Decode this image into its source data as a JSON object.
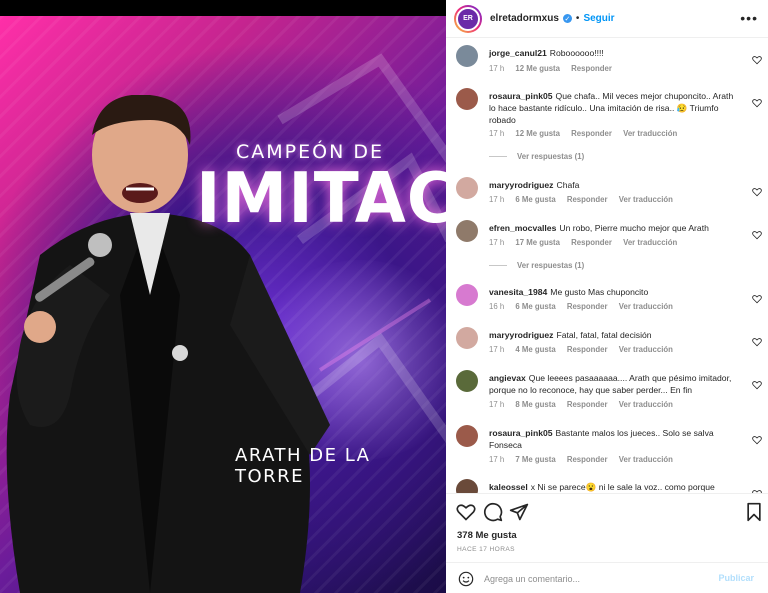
{
  "post": {
    "headline_small": "CAMPEÓN DE",
    "headline_big": "IMITACIÓN",
    "caption_name": "ARATH DE LA TORRE"
  },
  "header": {
    "username": "elretadormxus",
    "avatar_text": "EL RETADOR",
    "separator": "•",
    "follow_label": "Seguir",
    "more_label": "•••"
  },
  "comments": [
    {
      "user": "jorge_canul21",
      "text": "Roboooooo!!!!",
      "time": "17 h",
      "likes": "12 Me gusta",
      "reply": "Responder",
      "translate": "",
      "avatar_color": "#7a8a9a"
    },
    {
      "user": "rosaura_pink05",
      "text": "Que chafa.. Mil veces mejor chuponcito.. Arath lo hace bastante ridículo.. Una imitación de risa.. 😥 Triumfo robado",
      "time": "17 h",
      "likes": "12 Me gusta",
      "reply": "Responder",
      "translate": "Ver traducción",
      "avatar_color": "#9b5a4a"
    },
    {
      "user": "maryyrodriguez",
      "text": "Chafa",
      "time": "17 h",
      "likes": "6 Me gusta",
      "reply": "Responder",
      "translate": "Ver traducción",
      "avatar_color": "#d2a9a0"
    },
    {
      "user": "efren_mocvalles",
      "text": "Un robo, Pierre mucho mejor que Arath",
      "time": "17 h",
      "likes": "17 Me gusta",
      "reply": "Responder",
      "translate": "Ver traducción",
      "avatar_color": "#8f7a6a"
    },
    {
      "user": "vanesita_1984",
      "text": "Me gusto Mas chuponcito",
      "time": "16 h",
      "likes": "6 Me gusta",
      "reply": "Responder",
      "translate": "Ver traducción",
      "avatar_color": "#d77ad0"
    },
    {
      "user": "maryyrodriguez",
      "text": "Fatal, fatal, fatal decisión",
      "time": "17 h",
      "likes": "4 Me gusta",
      "reply": "Responder",
      "translate": "Ver traducción",
      "avatar_color": "#d2a9a0"
    },
    {
      "user": "angievax",
      "text": "Que leeees pasaaaaaa.... Arath que pésimo imitador, porque no lo reconoce, hay que saber perder... En fin",
      "time": "17 h",
      "likes": "8 Me gusta",
      "reply": "Responder",
      "translate": "Ver traducción",
      "avatar_color": "#5a6a3a"
    },
    {
      "user": "rosaura_pink05",
      "text": "Bastante malos los jueces.. Solo se salva Fonseca",
      "time": "17 h",
      "likes": "7 Me gusta",
      "reply": "Responder",
      "translate": "Ver traducción",
      "avatar_color": "#9b5a4a"
    },
    {
      "user": "kaleossel",
      "text": "x Ni se parece😮 ni le sale la voz.. como porque",
      "time": "",
      "likes": "",
      "reply": "",
      "translate": "",
      "avatar_color": "#6a4a3a"
    }
  ],
  "view_replies": [
    "Ver respuestas (1)",
    "Ver respuestas (1)"
  ],
  "actions": {
    "likes": "378 Me gusta",
    "time_ago": "HACE 17 HORAS",
    "input_placeholder": "Agrega un comentario...",
    "publish_label": "Publicar"
  },
  "colors": {
    "accent": "#0095f6",
    "publish_disabled": "#b2dffc",
    "muted": "#8e8e8e"
  }
}
